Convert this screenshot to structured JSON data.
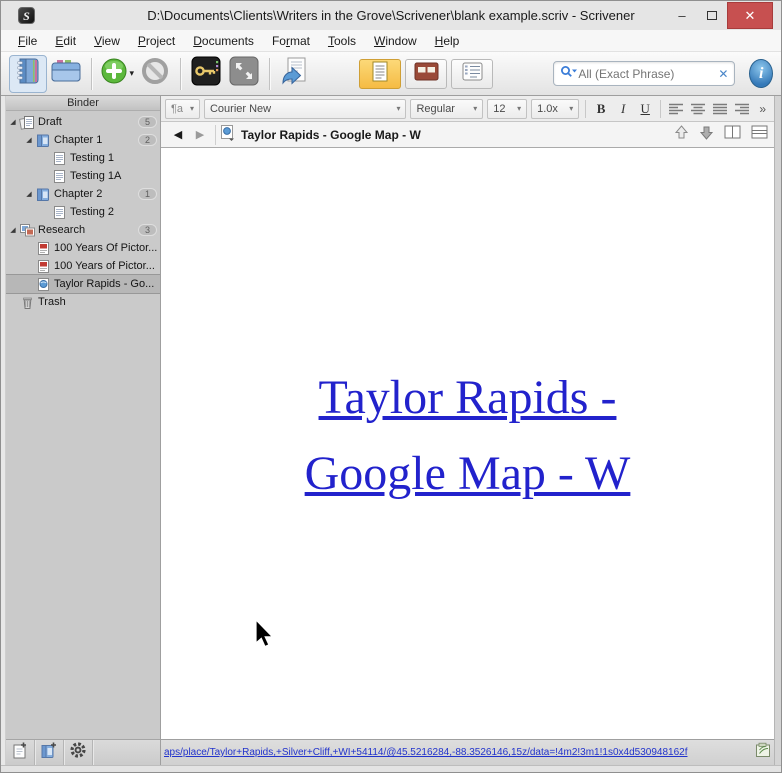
{
  "window": {
    "title": "D:\\Documents\\Clients\\Writers in the Grove\\Scrivener\\blank example.scriv - Scrivener",
    "logo_letter": "S",
    "minimize": "–",
    "close": "✕"
  },
  "menu": {
    "items": [
      {
        "pre": "",
        "key": "F",
        "post": "ile"
      },
      {
        "pre": "",
        "key": "E",
        "post": "dit"
      },
      {
        "pre": "",
        "key": "V",
        "post": "iew"
      },
      {
        "pre": "",
        "key": "P",
        "post": "roject"
      },
      {
        "pre": "",
        "key": "D",
        "post": "ocuments"
      },
      {
        "pre": "Fo",
        "key": "r",
        "post": "mat"
      },
      {
        "pre": "",
        "key": "T",
        "post": "ools"
      },
      {
        "pre": "",
        "key": "W",
        "post": "indow"
      },
      {
        "pre": "",
        "key": "H",
        "post": "elp"
      }
    ]
  },
  "toolbar": {
    "search_placeholder": "All (Exact Phrase)",
    "search_clear": "✕",
    "inspector_label": "i",
    "add_caret": "▾"
  },
  "format_bar": {
    "preset": "¶a",
    "font": "Courier New",
    "style": "Regular",
    "size": "12",
    "spacing": "1.0x",
    "bold": "B",
    "italic": "I",
    "underline": "U",
    "overflow": "»"
  },
  "editor_header": {
    "back": "◀",
    "forward": "▶",
    "title": "Taylor Rapids - Google Map - W"
  },
  "binder": {
    "header": "Binder",
    "items": [
      {
        "label": "Draft",
        "badge": "5",
        "depth": 0,
        "icon": "draft-stack-icon",
        "expanded": true,
        "selected": false
      },
      {
        "label": "Chapter 1",
        "badge": "2",
        "depth": 1,
        "icon": "chapter-folder-icon",
        "expanded": true,
        "selected": false
      },
      {
        "label": "Testing 1",
        "badge": "",
        "depth": 2,
        "icon": "text-doc-icon",
        "expanded": false,
        "selected": false
      },
      {
        "label": "Testing 1A",
        "badge": "",
        "depth": 2,
        "icon": "text-doc-icon",
        "expanded": false,
        "selected": false
      },
      {
        "label": "Chapter 2",
        "badge": "1",
        "depth": 1,
        "icon": "chapter-folder-icon",
        "expanded": true,
        "selected": false
      },
      {
        "label": "Testing 2",
        "badge": "",
        "depth": 2,
        "icon": "text-doc-icon",
        "expanded": false,
        "selected": false
      },
      {
        "label": "Research",
        "badge": "3",
        "depth": 0,
        "icon": "research-stack-icon",
        "expanded": true,
        "selected": false
      },
      {
        "label": "100 Years Of Pictor...",
        "badge": "",
        "depth": 1,
        "icon": "pdf-doc-icon",
        "expanded": false,
        "selected": false
      },
      {
        "label": "100 Years of Pictor...",
        "badge": "",
        "depth": 1,
        "icon": "pdf-doc-icon",
        "expanded": false,
        "selected": false
      },
      {
        "label": "Taylor Rapids - Go...",
        "badge": "",
        "depth": 1,
        "icon": "web-doc-icon",
        "expanded": false,
        "selected": true
      },
      {
        "label": "Trash",
        "badge": "",
        "depth": 0,
        "icon": "trash-icon",
        "expanded": false,
        "selected": false
      }
    ]
  },
  "editor": {
    "link_lines": [
      "Taylor Rapids -",
      "Google Map - W"
    ],
    "link_color": "#2222cc"
  },
  "footer": {
    "link": "aps/place/Taylor+Rapids,+Silver+Cliff,+WI+54114/@45.5216284,-88.3526146,15z/data=!4m2!3m1!1s0x4d530948162f"
  },
  "colors": {
    "close_red": "#c75050",
    "selection_amber": "#f5bb44",
    "accent_blue": "#3b7dd8",
    "link_blue": "#2222cc"
  }
}
